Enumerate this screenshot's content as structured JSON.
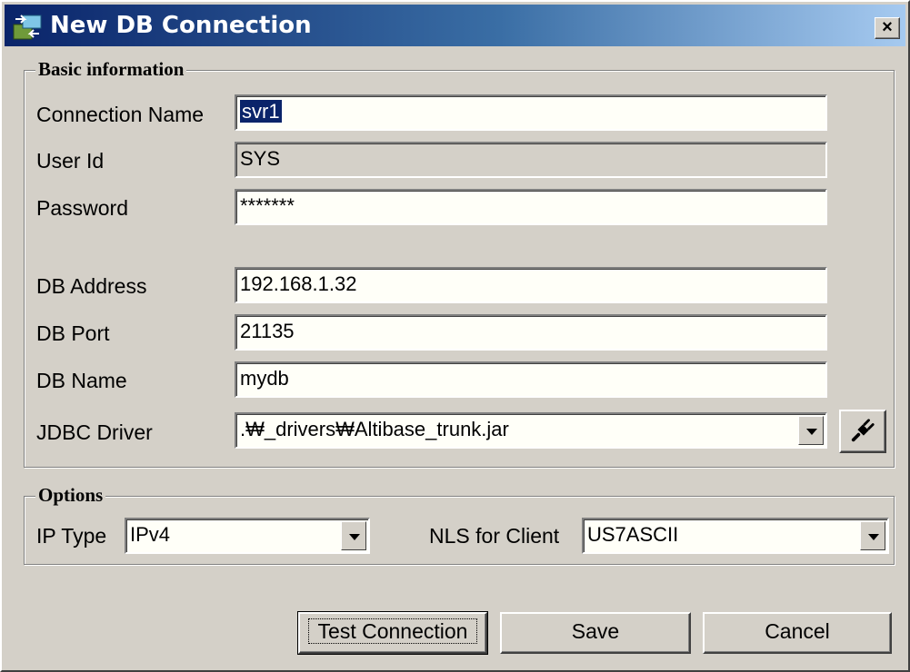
{
  "window": {
    "title": "New DB Connection",
    "close_label": "×"
  },
  "basic": {
    "legend": "Basic information",
    "connection_name": {
      "label": "Connection Name",
      "value": "svr1"
    },
    "user_id": {
      "label": "User Id",
      "value": "SYS"
    },
    "password": {
      "label": "Password",
      "value": "*******"
    },
    "db_address": {
      "label": "DB Address",
      "value": "192.168.1.32"
    },
    "db_port": {
      "label": "DB Port",
      "value": "21135"
    },
    "db_name": {
      "label": "DB Name",
      "value": "mydb"
    },
    "jdbc_driver": {
      "label": "JDBC Driver",
      "value": ".₩_drivers₩Altibase_trunk.jar"
    }
  },
  "options": {
    "legend": "Options",
    "ip_type": {
      "label": "IP Type",
      "value": "IPv4"
    },
    "nls": {
      "label": "NLS for Client",
      "value": "US7ASCII"
    }
  },
  "buttons": {
    "test": "Test Connection",
    "save": "Save",
    "cancel": "Cancel"
  }
}
